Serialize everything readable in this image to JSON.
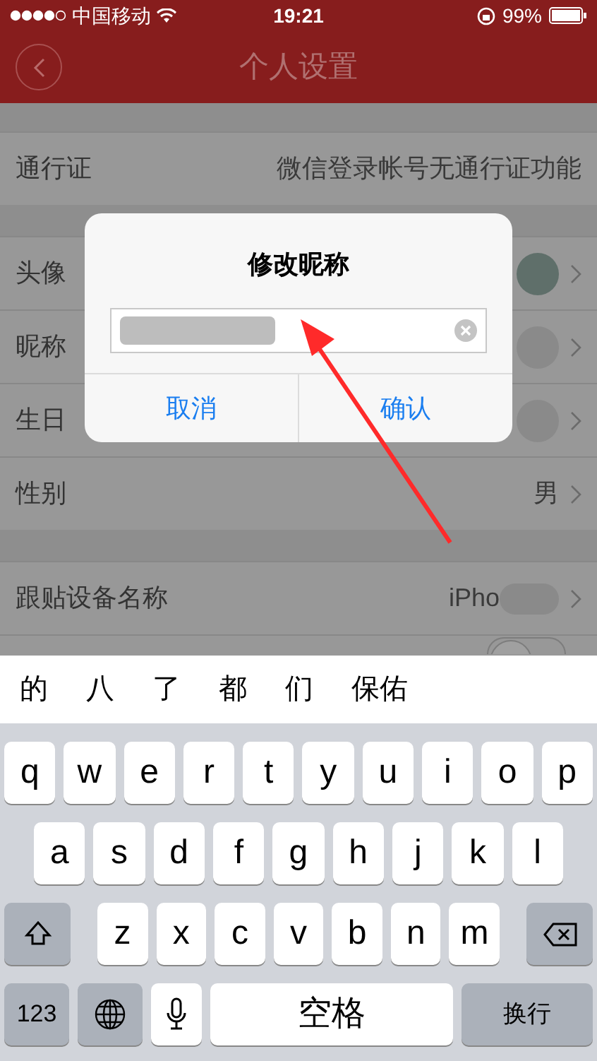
{
  "status_bar": {
    "carrier": "中国移动",
    "time": "19:21",
    "battery": "99%"
  },
  "nav_bar": {
    "title": "个人设置"
  },
  "sections": [
    {
      "rows": [
        {
          "kind": "text",
          "label": "通行证",
          "value": "微信登录帐号无通行证功能"
        }
      ]
    },
    {
      "rows": [
        {
          "kind": "avatar",
          "label": "头像"
        },
        {
          "kind": "redacted",
          "label": "昵称"
        },
        {
          "kind": "redacted",
          "label": "生日"
        },
        {
          "kind": "text",
          "label": "性别",
          "value": "男"
        }
      ]
    },
    {
      "rows": [
        {
          "kind": "partial",
          "label": "跟贴设备名称",
          "value": "iPho"
        },
        {
          "kind": "toggle",
          "on": false
        }
      ]
    }
  ],
  "dialog": {
    "title": "修改昵称",
    "buttons": [
      "取消",
      "确认"
    ]
  },
  "candidates": [
    "的",
    "八",
    "了",
    "都",
    "们",
    "保佑"
  ],
  "keyboard": {
    "rows": [
      [
        "q",
        "w",
        "e",
        "r",
        "t",
        "y",
        "u",
        "i",
        "o",
        "p"
      ],
      [
        "a",
        "s",
        "d",
        "f",
        "g",
        "h",
        "j",
        "k",
        "l"
      ],
      [
        "z",
        "x",
        "c",
        "v",
        "b",
        "n",
        "m"
      ]
    ],
    "numbers": "123",
    "space": "空格",
    "return": "换行"
  }
}
